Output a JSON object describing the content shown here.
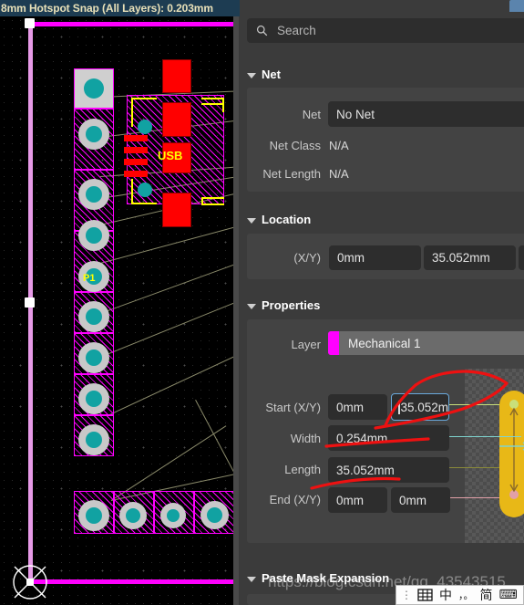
{
  "status_bar": {
    "text": "8mm Hotspot Snap (All Layers): 0.203mm"
  },
  "canvas": {
    "designator_connector": "P1",
    "designator_usb": "USB"
  },
  "panel": {
    "search": {
      "placeholder": "Search",
      "icon": "search-icon"
    },
    "sections": {
      "net": {
        "title": "Net",
        "rows": {
          "net_label": "Net",
          "net_value": "No Net",
          "net_class_label": "Net Class",
          "net_class_value": "N/A",
          "net_length_label": "Net Length",
          "net_length_value": "N/A"
        }
      },
      "location": {
        "title": "Location",
        "xy_label": "(X/Y)",
        "x_value": "0mm",
        "y_value": "35.052mm"
      },
      "properties": {
        "title": "Properties",
        "layer_label": "Layer",
        "layer_value": "Mechanical 1",
        "layer_color": "#ff00ff",
        "start_label": "Start (X/Y)",
        "start_x": "0mm",
        "start_y": "35.052m",
        "width_label": "Width",
        "width_value": "0.254mm",
        "length_label": "Length",
        "length_value": "35.052mm",
        "end_label": "End (X/Y)",
        "end_x": "0mm",
        "end_y": "0mm"
      },
      "paste_mask": {
        "title": "Paste Mask Expansion"
      }
    }
  },
  "watermark": {
    "text": "https://blog.csdn.net/qq_43543515"
  },
  "ime": {
    "dots": "⋮",
    "mode": "中",
    "punct": "，。",
    "simplified": "简",
    "pen": "⌨",
    "minimize": "−"
  },
  "colors": {
    "accent_blue": "#5b84ad",
    "focus_blue": "#6aa9dc",
    "annotation_red": "#ee1111",
    "board_magenta": "#ff00ff",
    "pad_teal": "#11a2a2",
    "track_gold": "#e8b817",
    "status_bg": "#1d3c52",
    "status_fg": "#e8e0b8"
  }
}
